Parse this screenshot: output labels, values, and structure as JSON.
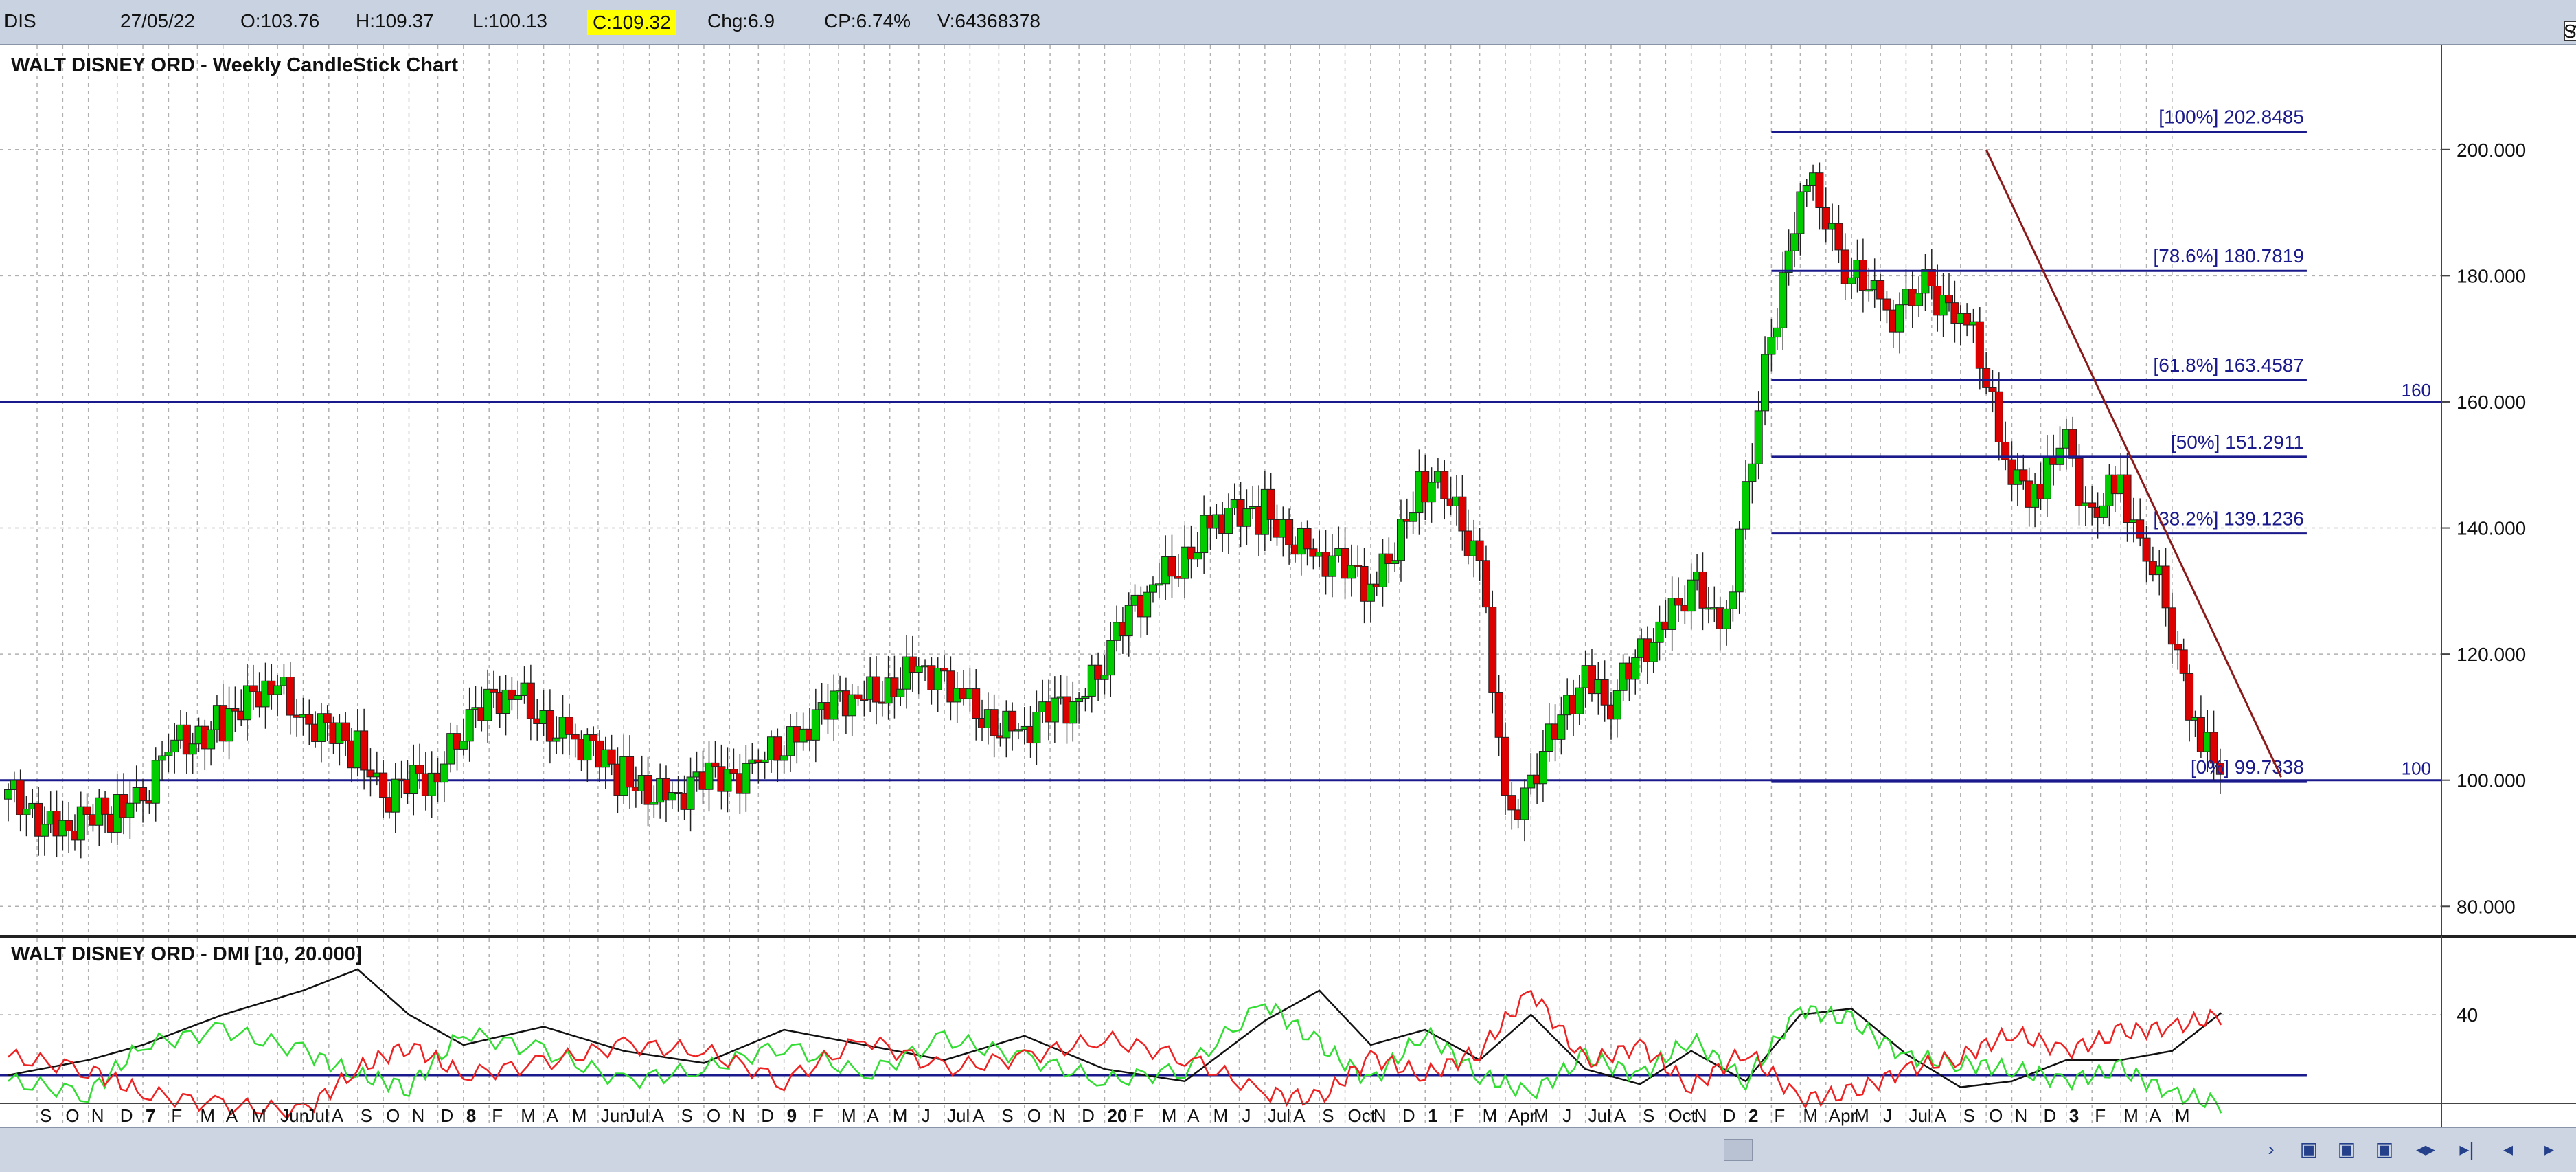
{
  "header": {
    "symbol": "DIS",
    "date": "27/05/22",
    "open": "O:103.76",
    "high": "H:109.37",
    "low": "L:100.13",
    "close": "C:109.32",
    "change": "Chg:6.9",
    "change_pct": "CP:6.74%",
    "volume": "V:64368378",
    "show_last_label": "Show Last",
    "show_last_checked": "✓"
  },
  "colors": {
    "up": "#00cc00",
    "down": "#dd0000",
    "fib": "#1a1a8c",
    "trend": "#8b1a1a",
    "grid": "#b0b0b0",
    "dmi_plus": "#33dd33",
    "dmi_minus": "#ee2222",
    "adx": "#111111"
  },
  "chart_data": [
    {
      "type": "candlestick",
      "title": "WALT DISNEY ORD - Weekly CandleStick Chart",
      "ylim": [
        76,
        210
      ],
      "yticks": [
        "80.000",
        "100.000",
        "120.000",
        "140.000",
        "160.000",
        "180.000",
        "200.000"
      ],
      "grid": true,
      "horizontal_lines": [
        {
          "value": 160,
          "label": "160"
        },
        {
          "value": 100,
          "label": "100"
        }
      ],
      "fibonacci": [
        {
          "label": "[100%] 202.8485",
          "value": 202.8485
        },
        {
          "label": "[78.6%] 180.7819",
          "value": 180.7819
        },
        {
          "label": "[61.8%] 163.4587",
          "value": 163.4587
        },
        {
          "label": "[50%] 151.2911",
          "value": 151.2911
        },
        {
          "label": "[38.2%] 139.1236",
          "value": 139.1236
        },
        {
          "label": "[0%] 99.7338",
          "value": 99.7338
        }
      ],
      "trendline": [
        {
          "x": 2021.75,
          "y": 200
        },
        {
          "x": 2022.67,
          "y": 100.5
        }
      ],
      "series": [
        {
          "x": 2015.58,
          "close": 97
        },
        {
          "x": 2015.75,
          "close": 93
        },
        {
          "x": 2015.92,
          "close": 94
        },
        {
          "x": 2016.0,
          "close": 98
        },
        {
          "x": 2016.08,
          "close": 105
        },
        {
          "x": 2016.25,
          "close": 110
        },
        {
          "x": 2016.42,
          "close": 114
        },
        {
          "x": 2016.5,
          "close": 110
        },
        {
          "x": 2016.67,
          "close": 104
        },
        {
          "x": 2016.75,
          "close": 98
        },
        {
          "x": 2016.92,
          "close": 100
        },
        {
          "x": 2017.0,
          "close": 110
        },
        {
          "x": 2017.17,
          "close": 113
        },
        {
          "x": 2017.33,
          "close": 107
        },
        {
          "x": 2017.5,
          "close": 100
        },
        {
          "x": 2017.67,
          "close": 98
        },
        {
          "x": 2017.92,
          "close": 103
        },
        {
          "x": 2018.08,
          "close": 110
        },
        {
          "x": 2018.25,
          "close": 113
        },
        {
          "x": 2018.42,
          "close": 118
        },
        {
          "x": 2018.58,
          "close": 111
        },
        {
          "x": 2018.75,
          "close": 108
        },
        {
          "x": 2018.92,
          "close": 113
        },
        {
          "x": 2019.0,
          "close": 120
        },
        {
          "x": 2019.17,
          "close": 132
        },
        {
          "x": 2019.33,
          "close": 140
        },
        {
          "x": 2019.5,
          "close": 143
        },
        {
          "x": 2019.67,
          "close": 135
        },
        {
          "x": 2019.83,
          "close": 131
        },
        {
          "x": 2020.0,
          "close": 147
        },
        {
          "x": 2020.08,
          "close": 145
        },
        {
          "x": 2020.17,
          "close": 135
        },
        {
          "x": 2020.25,
          "close": 95
        },
        {
          "x": 2020.33,
          "close": 99
        },
        {
          "x": 2020.5,
          "close": 118
        },
        {
          "x": 2020.58,
          "close": 112
        },
        {
          "x": 2020.75,
          "close": 126
        },
        {
          "x": 2020.83,
          "close": 132
        },
        {
          "x": 2020.92,
          "close": 122
        },
        {
          "x": 2021.0,
          "close": 145
        },
        {
          "x": 2021.08,
          "close": 170
        },
        {
          "x": 2021.17,
          "close": 195
        },
        {
          "x": 2021.25,
          "close": 190
        },
        {
          "x": 2021.33,
          "close": 180
        },
        {
          "x": 2021.42,
          "close": 175
        },
        {
          "x": 2021.5,
          "close": 175
        },
        {
          "x": 2021.58,
          "close": 178
        },
        {
          "x": 2021.67,
          "close": 175
        },
        {
          "x": 2021.83,
          "close": 150
        },
        {
          "x": 2021.92,
          "close": 145
        },
        {
          "x": 2022.0,
          "close": 155
        },
        {
          "x": 2022.08,
          "close": 140
        },
        {
          "x": 2022.17,
          "close": 148
        },
        {
          "x": 2022.25,
          "close": 135
        },
        {
          "x": 2022.33,
          "close": 125
        },
        {
          "x": 2022.42,
          "close": 105
        },
        {
          "x": 2022.48,
          "close": 101
        },
        {
          "x": 2022.5,
          "close": 109
        }
      ]
    },
    {
      "type": "line",
      "title": "WALT DISNEY ORD - DMI [10, 20.000]",
      "ylim": [
        5,
        55
      ],
      "yticks": [
        "40"
      ],
      "horizontal_lines": [
        {
          "value": 20
        }
      ],
      "series": [
        {
          "role": "adx",
          "x": [
            2015.58,
            2015.83,
            2016.0,
            2016.25,
            2016.5,
            2016.67,
            2016.83,
            2017.0,
            2017.25,
            2017.5,
            2017.75,
            2018.0,
            2018.25,
            2018.5,
            2018.75,
            2019.0,
            2019.25,
            2019.5,
            2019.67,
            2019.83,
            2020.0,
            2020.17,
            2020.33,
            2020.5,
            2020.67,
            2020.83,
            2021.0,
            2021.17,
            2021.33,
            2021.5,
            2021.67,
            2021.83,
            2022.0,
            2022.17,
            2022.33,
            2022.5
          ],
          "values": [
            20,
            25,
            30,
            40,
            48,
            55,
            40,
            30,
            36,
            28,
            24,
            35,
            30,
            25,
            33,
            22,
            18,
            38,
            48,
            30,
            35,
            25,
            40,
            22,
            17,
            28,
            18,
            40,
            42,
            27,
            16,
            18,
            25,
            25,
            28,
            42
          ]
        },
        {
          "role": "plus_di",
          "x": [
            2015.58,
            2015.83,
            2016.0,
            2016.25,
            2016.5,
            2016.67,
            2016.83,
            2017.0,
            2017.25,
            2017.5,
            2017.75,
            2018.0,
            2018.25,
            2018.5,
            2018.75,
            2019.0,
            2019.25,
            2019.5,
            2019.67,
            2019.83,
            2020.0,
            2020.17,
            2020.33,
            2020.5,
            2020.67,
            2020.83,
            2021.0,
            2021.17,
            2021.33,
            2021.5,
            2021.67,
            2021.83,
            2022.0,
            2022.17,
            2022.33,
            2022.5
          ],
          "values": [
            18,
            14,
            30,
            35,
            28,
            20,
            16,
            34,
            28,
            18,
            22,
            30,
            20,
            32,
            26,
            18,
            22,
            44,
            30,
            18,
            34,
            20,
            14,
            26,
            20,
            32,
            18,
            42,
            38,
            26,
            24,
            22,
            18,
            22,
            14,
            10
          ]
        },
        {
          "role": "minus_di",
          "x": [
            2015.58,
            2015.83,
            2016.0,
            2016.25,
            2016.5,
            2016.67,
            2016.83,
            2017.0,
            2017.25,
            2017.5,
            2017.75,
            2018.0,
            2018.25,
            2018.5,
            2018.75,
            2019.0,
            2019.25,
            2019.5,
            2019.67,
            2019.83,
            2020.0,
            2020.17,
            2020.33,
            2020.5,
            2020.67,
            2020.83,
            2021.0,
            2021.17,
            2021.33,
            2021.5,
            2021.67,
            2021.83,
            2022.0,
            2022.17,
            2022.33,
            2022.5
          ],
          "values": [
            26,
            22,
            14,
            10,
            8,
            22,
            30,
            20,
            24,
            30,
            28,
            18,
            32,
            22,
            26,
            32,
            26,
            14,
            12,
            26,
            20,
            28,
            48,
            24,
            30,
            16,
            28,
            12,
            14,
            22,
            26,
            34,
            28,
            34,
            36,
            40
          ]
        }
      ]
    }
  ],
  "xaxis": {
    "labels": [
      {
        "x": 2015.67,
        "t": "S"
      },
      {
        "x": 2015.75,
        "t": "O"
      },
      {
        "x": 2015.83,
        "t": "N"
      },
      {
        "x": 2015.92,
        "t": "D"
      },
      {
        "x": 2016.0,
        "t": "7"
      },
      {
        "x": 2016.08,
        "t": "F"
      },
      {
        "x": 2016.17,
        "t": "M"
      },
      {
        "x": 2016.25,
        "t": "A"
      },
      {
        "x": 2016.33,
        "t": "M"
      },
      {
        "x": 2016.42,
        "t": "Jun"
      },
      {
        "x": 2016.5,
        "t": "Jul"
      },
      {
        "x": 2016.58,
        "t": "A"
      },
      {
        "x": 2016.67,
        "t": "S"
      },
      {
        "x": 2016.75,
        "t": "O"
      },
      {
        "x": 2016.83,
        "t": "N"
      },
      {
        "x": 2016.92,
        "t": "D"
      },
      {
        "x": 2017.0,
        "t": "8"
      },
      {
        "x": 2017.08,
        "t": "F"
      },
      {
        "x": 2017.17,
        "t": "M"
      },
      {
        "x": 2017.25,
        "t": "A"
      },
      {
        "x": 2017.33,
        "t": "M"
      },
      {
        "x": 2017.42,
        "t": "Jun"
      },
      {
        "x": 2017.5,
        "t": "Jul"
      },
      {
        "x": 2017.58,
        "t": "A"
      },
      {
        "x": 2017.67,
        "t": "S"
      },
      {
        "x": 2017.75,
        "t": "O"
      },
      {
        "x": 2017.83,
        "t": "N"
      },
      {
        "x": 2017.92,
        "t": "D"
      },
      {
        "x": 2018.0,
        "t": "9"
      },
      {
        "x": 2018.08,
        "t": "F"
      },
      {
        "x": 2018.17,
        "t": "M"
      },
      {
        "x": 2018.25,
        "t": "A"
      },
      {
        "x": 2018.33,
        "t": "M"
      },
      {
        "x": 2018.42,
        "t": "J"
      },
      {
        "x": 2018.5,
        "t": "Jul"
      },
      {
        "x": 2018.58,
        "t": "A"
      },
      {
        "x": 2018.67,
        "t": "S"
      },
      {
        "x": 2018.75,
        "t": "O"
      },
      {
        "x": 2018.83,
        "t": "N"
      },
      {
        "x": 2018.92,
        "t": "D"
      },
      {
        "x": 2019.0,
        "t": "20"
      },
      {
        "x": 2019.08,
        "t": "F"
      },
      {
        "x": 2019.17,
        "t": "M"
      },
      {
        "x": 2019.25,
        "t": "A"
      },
      {
        "x": 2019.33,
        "t": "M"
      },
      {
        "x": 2019.42,
        "t": "J"
      },
      {
        "x": 2019.5,
        "t": "Jul"
      },
      {
        "x": 2019.58,
        "t": "A"
      },
      {
        "x": 2019.67,
        "t": "S"
      },
      {
        "x": 2019.75,
        "t": "Oct"
      },
      {
        "x": 2019.83,
        "t": "N"
      },
      {
        "x": 2019.92,
        "t": "D"
      },
      {
        "x": 2020.0,
        "t": "1"
      },
      {
        "x": 2020.08,
        "t": "F"
      },
      {
        "x": 2020.17,
        "t": "M"
      },
      {
        "x": 2020.25,
        "t": "Apr"
      },
      {
        "x": 2020.33,
        "t": "M"
      },
      {
        "x": 2020.42,
        "t": "J"
      },
      {
        "x": 2020.5,
        "t": "Jul"
      },
      {
        "x": 2020.58,
        "t": "A"
      },
      {
        "x": 2020.67,
        "t": "S"
      },
      {
        "x": 2020.75,
        "t": "Oct"
      },
      {
        "x": 2020.83,
        "t": "N"
      },
      {
        "x": 2020.92,
        "t": "D"
      },
      {
        "x": 2021.0,
        "t": "2"
      },
      {
        "x": 2021.08,
        "t": "F"
      },
      {
        "x": 2021.17,
        "t": "M"
      },
      {
        "x": 2021.25,
        "t": "Apr"
      },
      {
        "x": 2021.33,
        "t": "M"
      },
      {
        "x": 2021.42,
        "t": "J"
      },
      {
        "x": 2021.5,
        "t": "Jul"
      },
      {
        "x": 2021.58,
        "t": "A"
      },
      {
        "x": 2021.67,
        "t": "S"
      },
      {
        "x": 2021.75,
        "t": "O"
      },
      {
        "x": 2021.83,
        "t": "N"
      },
      {
        "x": 2021.92,
        "t": "D"
      },
      {
        "x": 2022.0,
        "t": "3"
      },
      {
        "x": 2022.08,
        "t": "F"
      },
      {
        "x": 2022.17,
        "t": "M"
      },
      {
        "x": 2022.25,
        "t": "A"
      },
      {
        "x": 2022.33,
        "t": "M"
      }
    ]
  }
}
